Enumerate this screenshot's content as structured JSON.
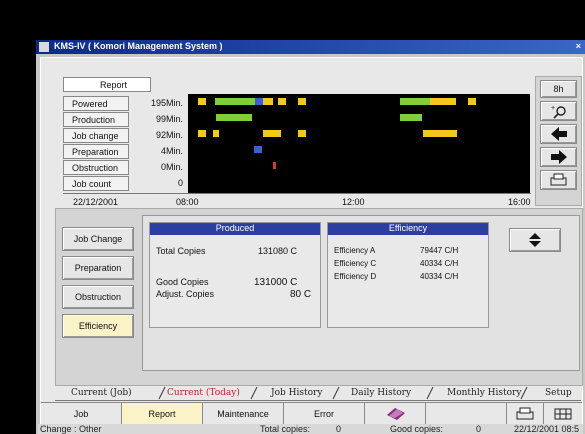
{
  "window": {
    "title": "KMS-IV ( Komori Management System )",
    "close": "×"
  },
  "report_label": "Report",
  "rows": [
    {
      "label": "Powered",
      "value": "195Min."
    },
    {
      "label": "Production",
      "value": "99Min."
    },
    {
      "label": "Job change",
      "value": "92Min."
    },
    {
      "label": "Preparation",
      "value": "4Min."
    },
    {
      "label": "Obstruction",
      "value": "0Min."
    },
    {
      "label": "Job count",
      "value": "0"
    }
  ],
  "date": "22/12/2001",
  "time_ticks": [
    "08:00",
    "12:00",
    "16:00"
  ],
  "right_tools": {
    "hours": "8h"
  },
  "side_buttons": [
    "Job Change",
    "Preparation",
    "Obstruction",
    "Efficiency"
  ],
  "produced": {
    "header": "Produced",
    "total_label": "Total Copies",
    "total_value": "131080 C",
    "good_label": "Good Copies",
    "good_value": "131000 C",
    "adjust_label": "Adjust. Copies",
    "adjust_value": "80 C"
  },
  "efficiency": {
    "header": "Efficiency",
    "items": [
      {
        "label": "Efficiency A",
        "value": "79447 C/H"
      },
      {
        "label": "Efficiency C",
        "value": "40334 C/H"
      },
      {
        "label": "Efficiency D",
        "value": "40334 C/H"
      }
    ]
  },
  "tabs": [
    "Current (Job)",
    "Current (Today)",
    "Job History",
    "Daily History",
    "Monthly History",
    "Setup"
  ],
  "bottom_buttons": [
    "Job",
    "Report",
    "Maintenance",
    "Error"
  ],
  "status": {
    "change": "Change : Other",
    "total_label": "Total copies:",
    "total_value": "0",
    "good_label": "Good copies:",
    "good_value": "0",
    "datetime": "22/12/2001 08:5"
  },
  "colors": {
    "green": "#7fcf3a",
    "yellow": "#f2c81e",
    "blue": "#3a5fd0",
    "red": "#d23a2a",
    "header_blue": "#2c3ea2"
  }
}
